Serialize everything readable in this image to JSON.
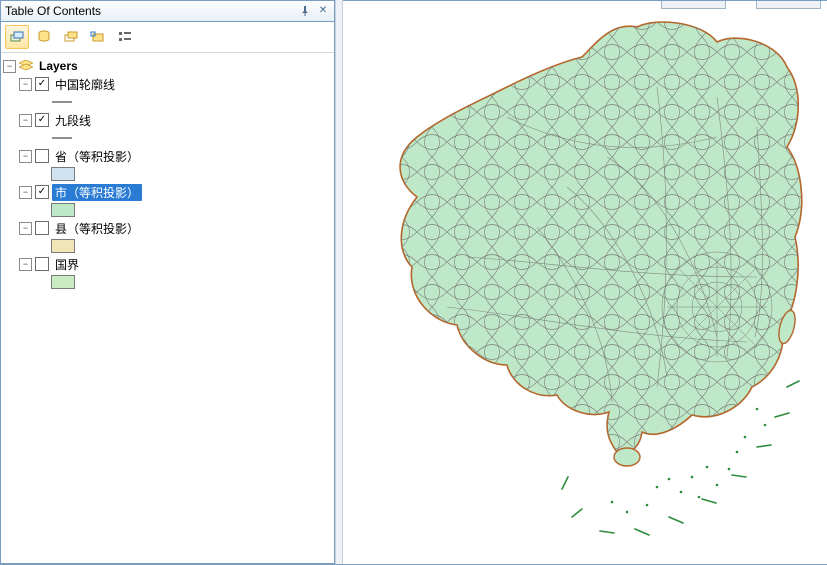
{
  "panel": {
    "title": "Table Of Contents"
  },
  "toolbar": {
    "buttons": [
      "list-by-drawing-order",
      "list-by-source",
      "list-by-visibility",
      "list-by-selection",
      "options"
    ]
  },
  "tree": {
    "root": "Layers",
    "items": [
      {
        "label": "中国轮廓线",
        "checked": true,
        "selected": false,
        "swatch": null
      },
      {
        "label": "九段线",
        "checked": true,
        "selected": false,
        "swatch": null
      },
      {
        "label": "省（等积投影）",
        "checked": false,
        "selected": false,
        "swatch": "#cfe3f2"
      },
      {
        "label": "市（等积投影）",
        "checked": true,
        "selected": true,
        "swatch": "#bfe8c8"
      },
      {
        "label": "县（等积投影）",
        "checked": false,
        "selected": false,
        "swatch": "#f2e6b8"
      },
      {
        "label": "国界",
        "checked": false,
        "selected": false,
        "swatch": "#c9ebc1"
      }
    ]
  },
  "map": {
    "fill": "#bfe8c8",
    "boundary": "#7a7f7a",
    "outline": "#b5652a",
    "dash": "#2e8b3d"
  }
}
